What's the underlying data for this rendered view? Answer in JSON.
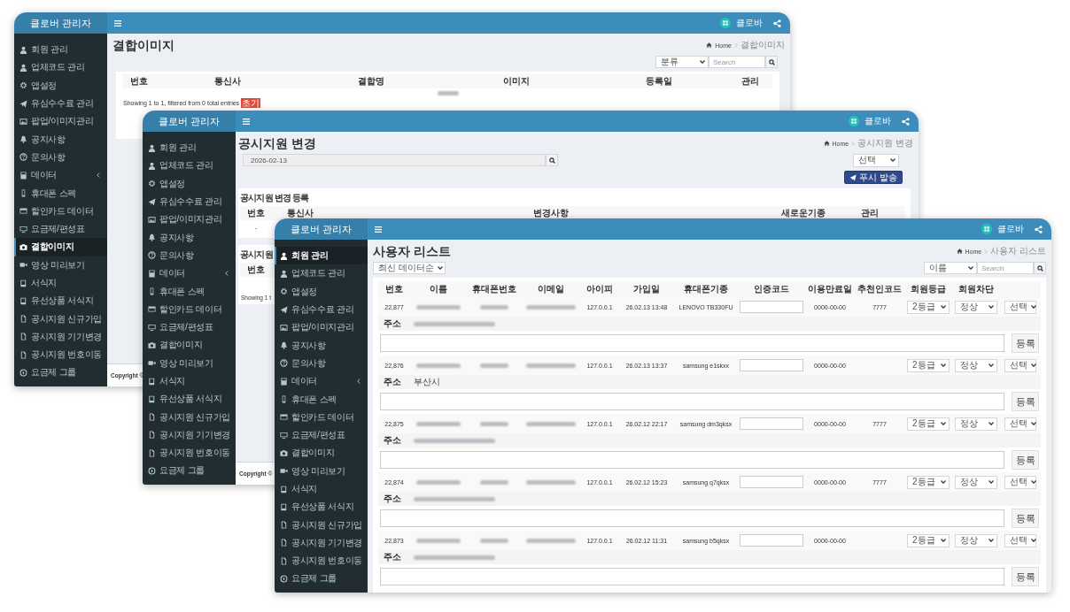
{
  "windows": [
    {
      "kind": "image_list",
      "brand": "클로버 관리자",
      "user_name": "클로바",
      "sidebar": [
        {
          "label": "회원 관리",
          "selected": false,
          "submenu": false
        },
        {
          "label": "업체코드 관리",
          "selected": false,
          "submenu": false
        },
        {
          "label": "앱설정",
          "selected": false,
          "submenu": false
        },
        {
          "label": "유심수수료 관리",
          "selected": false,
          "submenu": false
        },
        {
          "label": "팝업/이미지관리",
          "selected": false,
          "submenu": false
        },
        {
          "label": "공지사항",
          "selected": false,
          "submenu": false
        },
        {
          "label": "문의사항",
          "selected": false,
          "submenu": false
        },
        {
          "label": "데이터",
          "selected": false,
          "submenu": true
        },
        {
          "label": "휴대폰 스펙",
          "selected": false,
          "submenu": false
        },
        {
          "label": "할인카드 데이터",
          "selected": false,
          "submenu": false
        },
        {
          "label": "요금제/편성표",
          "selected": false,
          "submenu": false
        },
        {
          "label": "결합이미지",
          "selected": true,
          "submenu": false
        },
        {
          "label": "영상 미리보기",
          "selected": false,
          "submenu": false
        },
        {
          "label": "서식지",
          "selected": false,
          "submenu": false
        },
        {
          "label": "유선상품 서식지",
          "selected": false,
          "submenu": false
        },
        {
          "label": "공시지원 신규가입",
          "selected": false,
          "submenu": false
        },
        {
          "label": "공시지원 기기변경",
          "selected": false,
          "submenu": false
        },
        {
          "label": "공시지원 번호이동",
          "selected": false,
          "submenu": false
        },
        {
          "label": "요금제 그룹",
          "selected": false,
          "submenu": false
        }
      ],
      "title": "결합이미지",
      "breadcrumb": {
        "home": "Home",
        "current": "결합이미지"
      },
      "category_select": "분류",
      "search": {
        "placeholder": "Search"
      },
      "columns": [
        "번호",
        "통신사",
        "결합명",
        "이미지",
        "등록일",
        "관리"
      ],
      "rows": [
        {
          "blurred": true
        }
      ],
      "info": "Showing 1 to 1, filtered from 0 total entries",
      "info_badge": "초기",
      "footer": "Copyright ©"
    },
    {
      "kind": "push_change",
      "brand": "클로버 관리자",
      "user_name": "클로바",
      "sidebar": [
        {
          "label": "회원 관리",
          "selected": false,
          "submenu": false
        },
        {
          "label": "업체코드 관리",
          "selected": false,
          "submenu": false
        },
        {
          "label": "앱설정",
          "selected": false,
          "submenu": false
        },
        {
          "label": "유심수수료 관리",
          "selected": false,
          "submenu": false
        },
        {
          "label": "팝업/이미지관리",
          "selected": false,
          "submenu": false
        },
        {
          "label": "공지사항",
          "selected": false,
          "submenu": false
        },
        {
          "label": "문의사항",
          "selected": false,
          "submenu": false
        },
        {
          "label": "데이터",
          "selected": false,
          "submenu": true
        },
        {
          "label": "휴대폰 스펙",
          "selected": false,
          "submenu": false
        },
        {
          "label": "할인카드 데이터",
          "selected": false,
          "submenu": false
        },
        {
          "label": "요금제/편성표",
          "selected": false,
          "submenu": false
        },
        {
          "label": "결합이미지",
          "selected": false,
          "submenu": false
        },
        {
          "label": "영상 미리보기",
          "selected": false,
          "submenu": false
        },
        {
          "label": "서식지",
          "selected": false,
          "submenu": false
        },
        {
          "label": "유선상품 서식지",
          "selected": false,
          "submenu": false
        },
        {
          "label": "공시지원 신규가입",
          "selected": false,
          "submenu": false
        },
        {
          "label": "공시지원 기기변경",
          "selected": false,
          "submenu": false
        },
        {
          "label": "공시지원 번호이동",
          "selected": false,
          "submenu": false
        },
        {
          "label": "요금제 그룹",
          "selected": false,
          "submenu": false
        }
      ],
      "title": "공시지원 변경",
      "breadcrumb": {
        "home": "Home",
        "current": "공시지원 변경"
      },
      "date": "2026-02-13",
      "select": "선택",
      "push_button": "푸시 발송",
      "cards": [
        {
          "title": "공시지원 변경 등록",
          "columns": [
            "번호",
            "통신사",
            "변경사항",
            "새로운기종",
            "관리"
          ],
          "rows": [
            [
              "-"
            ]
          ]
        },
        {
          "title": "공시지원",
          "columns": [
            "번호"
          ],
          "info": "Showing 1 t"
        }
      ],
      "footer": "Copyright ©"
    },
    {
      "kind": "user_list",
      "brand": "클로버 관리자",
      "user_name": "클로바",
      "sidebar": [
        {
          "label": "회원 관리",
          "selected": true,
          "submenu": false
        },
        {
          "label": "업체코드 관리",
          "selected": false,
          "submenu": false
        },
        {
          "label": "앱설정",
          "selected": false,
          "submenu": false
        },
        {
          "label": "유심수수료 관리",
          "selected": false,
          "submenu": false
        },
        {
          "label": "팝업/이미지관리",
          "selected": false,
          "submenu": false
        },
        {
          "label": "공지사항",
          "selected": false,
          "submenu": false
        },
        {
          "label": "문의사항",
          "selected": false,
          "submenu": false
        },
        {
          "label": "데이터",
          "selected": false,
          "submenu": true
        },
        {
          "label": "휴대폰 스펙",
          "selected": false,
          "submenu": false
        },
        {
          "label": "할인카드 데이터",
          "selected": false,
          "submenu": false
        },
        {
          "label": "요금제/편성표",
          "selected": false,
          "submenu": false
        },
        {
          "label": "결합이미지",
          "selected": false,
          "submenu": false
        },
        {
          "label": "영상 미리보기",
          "selected": false,
          "submenu": false
        },
        {
          "label": "서식지",
          "selected": false,
          "submenu": false
        },
        {
          "label": "유선상품 서식지",
          "selected": false,
          "submenu": false
        },
        {
          "label": "공시지원 신규가입",
          "selected": false,
          "submenu": false
        },
        {
          "label": "공시지원 기기변경",
          "selected": false,
          "submenu": false
        },
        {
          "label": "공시지원 번호이동",
          "selected": false,
          "submenu": false
        },
        {
          "label": "요금제 그룹",
          "selected": false,
          "submenu": false
        }
      ],
      "title": "사용자 리스트",
      "breadcrumb": {
        "home": "Home",
        "current": "사용자 리스트"
      },
      "sort_select": "최신 데이터순",
      "field_select": "이름",
      "search": {
        "placeholder": "Search"
      },
      "columns": [
        "번호",
        "이름",
        "휴대폰번호",
        "이메일",
        "아이피",
        "가입일",
        "휴대폰기종",
        "인증코드",
        "이용만료일",
        "추천인코드",
        "회원등급",
        "회원차단"
      ],
      "rows": [
        {
          "no": "22,877",
          "name_blurred": true,
          "phone_blurred": true,
          "email_blurred": true,
          "ip": "127.0.0.1",
          "joined": "26.02.13 13:48",
          "device": "LENOVO TB330FU",
          "expires": "0000-00-00",
          "referrer": "7777",
          "grade": "2등급",
          "status": "정상",
          "action": "선택",
          "address_label": "주소",
          "address_blurred": true,
          "button": "등록"
        },
        {
          "no": "22,876",
          "name_blurred": true,
          "phone_blurred": true,
          "email_blurred": true,
          "ip": "127.0.0.1",
          "joined": "26.02.13 13:37",
          "device": "samsung e1skxx",
          "expires": "0000-00-00",
          "grade": "2등급",
          "status": "정상",
          "action": "선택",
          "address_label": "주소",
          "address": "부산시",
          "button": "등록"
        },
        {
          "no": "22,875",
          "name_blurred": true,
          "phone_blurred": true,
          "email_blurred": true,
          "ip": "127.0.0.1",
          "joined": "26.02.12 22:17",
          "device": "samsung dm3qksx",
          "expires": "0000-00-00",
          "referrer": "7777",
          "grade": "2등급",
          "status": "정상",
          "action": "선택",
          "address_label": "주소",
          "address_blurred": true,
          "button": "등록"
        },
        {
          "no": "22,874",
          "name_blurred": true,
          "phone_blurred": true,
          "email_blurred": true,
          "ip": "127.0.0.1",
          "joined": "26.02.12 15:23",
          "device": "samsung q7qksx",
          "expires": "0000-00-00",
          "referrer": "7777",
          "grade": "2등급",
          "status": "정상",
          "action": "선택",
          "address_label": "주소",
          "address_blurred": true,
          "button": "등록"
        },
        {
          "no": "22,873",
          "name_blurred": true,
          "phone_blurred": true,
          "email_blurred": true,
          "ip": "127.0.0.1",
          "joined": "26.02.12 11:31",
          "device": "samsung b5qksx",
          "expires": "0000-00-00",
          "grade": "2등급",
          "status": "정상",
          "action": "선택",
          "address_label": "주소",
          "address_blurred": true,
          "button": "등록"
        }
      ]
    }
  ]
}
